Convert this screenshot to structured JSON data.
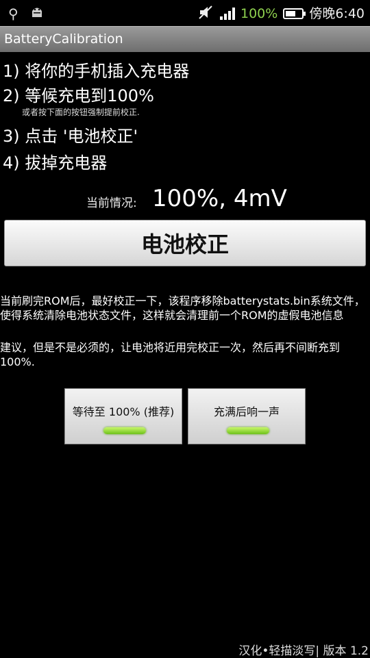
{
  "statusbar": {
    "battery_percent": "100%",
    "time": "傍晚6:40",
    "icons": [
      "usb-icon",
      "android-debug-icon",
      "mute-icon",
      "signal-icon",
      "battery-charging-icon"
    ]
  },
  "app": {
    "title": "BatteryCalibration"
  },
  "steps": [
    "1) 将你的手机插入充电器",
    "2) 等候充电到100%",
    "3) 点击 '电池校正'",
    "4) 拔掉充电器"
  ],
  "hint": "或者按下面的按钮强制提前校正.",
  "status": {
    "label": "当前情况:",
    "value": "100%, 4mV"
  },
  "calibrate_button": "电池校正",
  "description": [
    "当前刷完ROM后，最好校正一下，该程序移除batterystats.bin系统文件，使得系统清除电池状态文件，这样就会清理前一个ROM的虚假电池信息",
    "建议，但是不是必须的，让电池将近用完校正一次，然后再不间断充到100%."
  ],
  "toggles": [
    {
      "label": "等待至 100% (推荐)",
      "on": true
    },
    {
      "label": "充满后响一声",
      "on": true
    }
  ],
  "colors": {
    "indicator": "#8ee63a",
    "accent_text": "#8fd14f",
    "titlebar": "#808080"
  },
  "footer": "汉化•轻描淡写| 版本 1.2"
}
